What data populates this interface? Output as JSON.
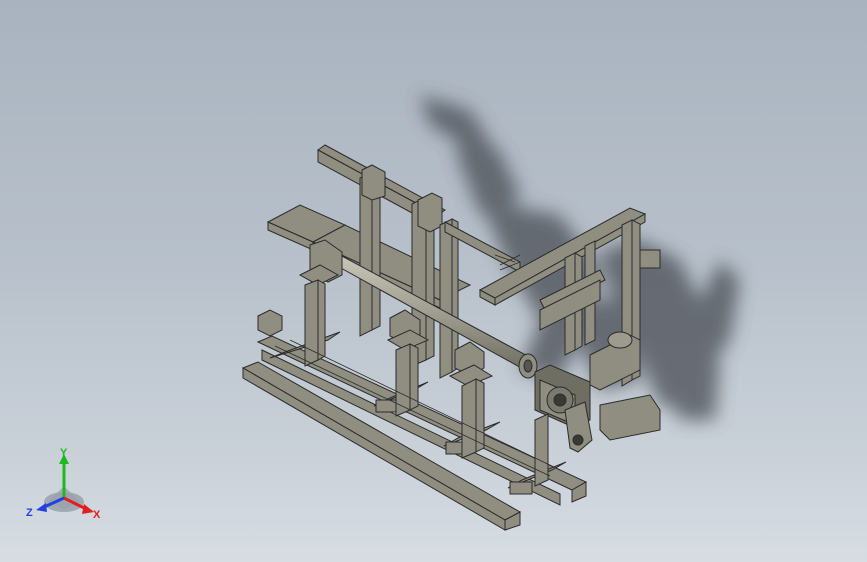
{
  "viewport": {
    "background_top": "#a9b3bf",
    "background_bottom": "#d7dde3"
  },
  "model": {
    "body_color": "#8f8e80",
    "edge_color": "#2b2b2b",
    "shadow_color": "#4a4e55"
  },
  "triad": {
    "x_label": "X",
    "y_label": "Y",
    "z_label": "Z",
    "x_color": "#e02020",
    "y_color": "#1fb81f",
    "z_color": "#2040e0"
  }
}
